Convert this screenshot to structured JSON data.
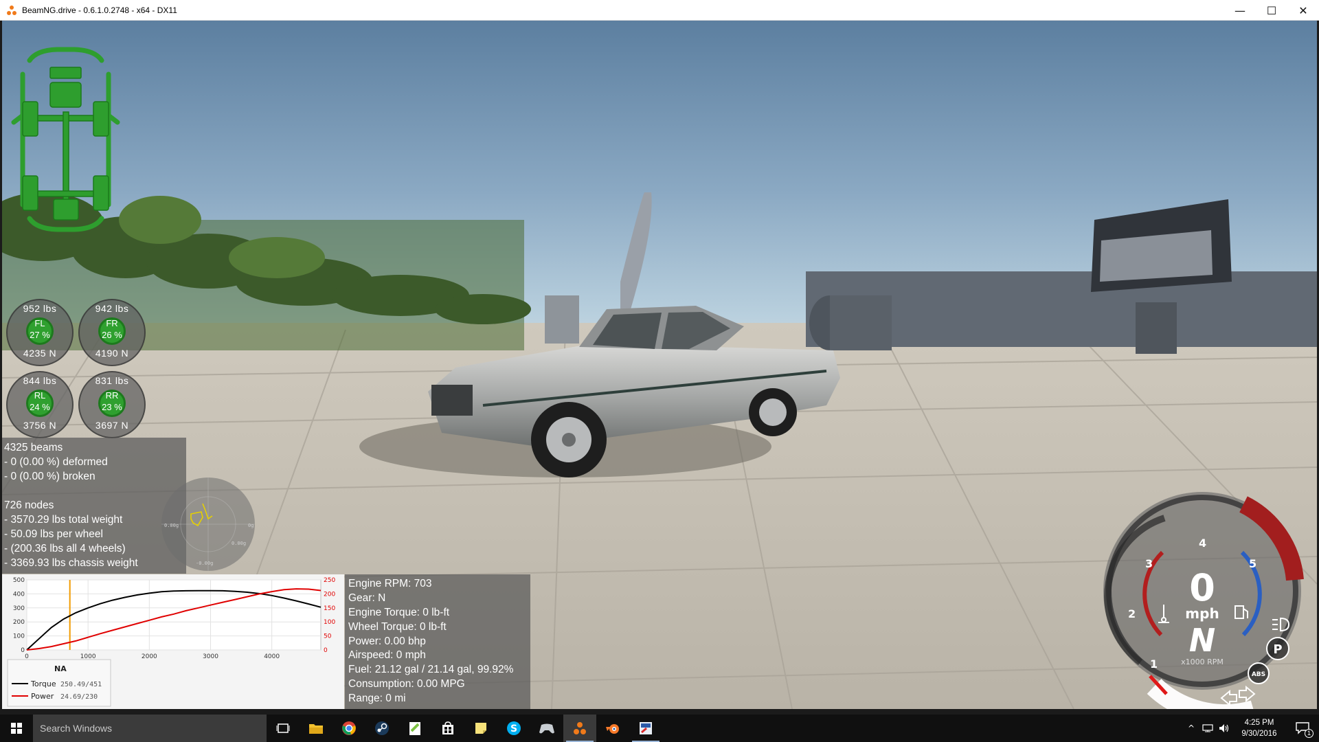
{
  "window": {
    "title": "BeamNG.drive - 0.6.1.0.2748 - x64 - DX11",
    "minimize": "—",
    "maximize": "☐",
    "close": "✕"
  },
  "wheels": [
    {
      "id": "fl",
      "name": "FL",
      "lbs": "952  lbs",
      "pct": "27  %",
      "newton": "4235  N"
    },
    {
      "id": "fr",
      "name": "FR",
      "lbs": "942  lbs",
      "pct": "26  %",
      "newton": "4190  N"
    },
    {
      "id": "rl",
      "name": "RL",
      "lbs": "844  lbs",
      "pct": "24  %",
      "newton": "3756  N"
    },
    {
      "id": "rr",
      "name": "RR",
      "lbs": "831  lbs",
      "pct": "23  %",
      "newton": "3697  N"
    }
  ],
  "stats": {
    "lines": [
      "4325 beams",
      "- 0 (0.00 %) deformed",
      "- 0 (0.00 %) broken",
      "",
      "726 nodes",
      "- 3570.29 lbs total weight",
      "- 50.09 lbs per wheel",
      "- (200.36 lbs all 4 wheels)",
      "- 3369.93 lbs chassis weight"
    ]
  },
  "gforce": {
    "label_left": "0.00g",
    "label_right": "0g",
    "label_bottom_right": "0.00g",
    "label_bottom": "-0.00g"
  },
  "engine": {
    "lines": [
      "Engine RPM: 703",
      "Gear: N",
      "Engine Torque: 0 lb-ft",
      "Wheel Torque: 0 lb-ft",
      "Power: 0.00 bhp",
      "Airspeed: 0 mph",
      "Fuel: 21.12 gal / 21.14 gal, 99.92%",
      "Consumption: 0.00 MPG",
      "Range: 0 mi"
    ]
  },
  "chart_data": {
    "type": "line",
    "title": "",
    "xlabel": "",
    "ylabel": "",
    "x_ticks": [
      0,
      1000,
      2000,
      3000,
      4000
    ],
    "xlim": [
      0,
      4800
    ],
    "ylim_left": [
      0,
      500
    ],
    "ylim_right": [
      0,
      250
    ],
    "y_ticks_left": [
      0,
      100,
      200,
      300,
      400,
      500
    ],
    "y_ticks_right": [
      0,
      50,
      100,
      150,
      200,
      250
    ],
    "current_rpm": 703,
    "legend_title": "NA",
    "series": [
      {
        "name": "Torque",
        "value_label": "250.49/451",
        "axis": "left",
        "color": "#000000",
        "x": [
          0,
          200,
          400,
          600,
          800,
          1000,
          1200,
          1400,
          1600,
          1800,
          2000,
          2200,
          2400,
          2600,
          2800,
          3000,
          3200,
          3400,
          3600,
          3800,
          4000,
          4200,
          4400,
          4600,
          4800
        ],
        "y": [
          0,
          80,
          160,
          220,
          265,
          300,
          330,
          355,
          375,
          392,
          405,
          415,
          420,
          422,
          423,
          423,
          422,
          418,
          412,
          402,
          388,
          370,
          350,
          328,
          305
        ]
      },
      {
        "name": "Power",
        "value_label": "24.69/230",
        "axis": "right",
        "color": "#e00000",
        "x": [
          0,
          200,
          400,
          600,
          800,
          1000,
          1200,
          1400,
          1600,
          1800,
          2000,
          2200,
          2400,
          2600,
          2800,
          3000,
          3200,
          3400,
          3600,
          3800,
          4000,
          4200,
          4400,
          4600,
          4800
        ],
        "y": [
          0,
          5,
          12,
          22,
          32,
          45,
          58,
          70,
          82,
          94,
          106,
          118,
          128,
          140,
          150,
          160,
          170,
          180,
          190,
          200,
          208,
          215,
          218,
          217,
          212
        ]
      }
    ]
  },
  "speedo": {
    "speed": "0",
    "unit": "mph",
    "gear": "N",
    "rpm_label": "x1000 RPM",
    "ticks": [
      "1",
      "2",
      "3",
      "4",
      "5"
    ],
    "parking": "P",
    "abs": "ABS",
    "rpm_value": 0.703
  },
  "taskbar": {
    "search_placeholder": "Search Windows",
    "time": "4:25 PM",
    "date": "9/30/2016",
    "notification_count": "1"
  }
}
